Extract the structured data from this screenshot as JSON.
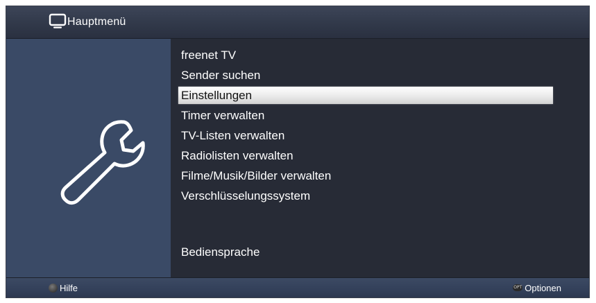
{
  "header": {
    "icon": "tv-icon",
    "title": "Hauptmenü"
  },
  "sidebar": {
    "icon": "wrench-icon"
  },
  "menu": {
    "items": [
      {
        "label": "freenet TV",
        "selected": false
      },
      {
        "label": "Sender suchen",
        "selected": false
      },
      {
        "label": "Einstellungen",
        "selected": true
      },
      {
        "label": "Timer verwalten",
        "selected": false
      },
      {
        "label": "TV-Listen verwalten",
        "selected": false
      },
      {
        "label": "Radiolisten verwalten",
        "selected": false
      },
      {
        "label": "Filme/Musik/Bilder verwalten",
        "selected": false
      },
      {
        "label": "Verschlüsselungssystem",
        "selected": false
      },
      {
        "label": "Bediensprache",
        "selected": false
      }
    ]
  },
  "footer": {
    "help_label": "Hilfe",
    "options_key": "OPT",
    "options_label": "Optionen"
  },
  "colors": {
    "background": "#272b36",
    "sidebar": "#3a4a66",
    "selection": "#e8e8e8"
  }
}
